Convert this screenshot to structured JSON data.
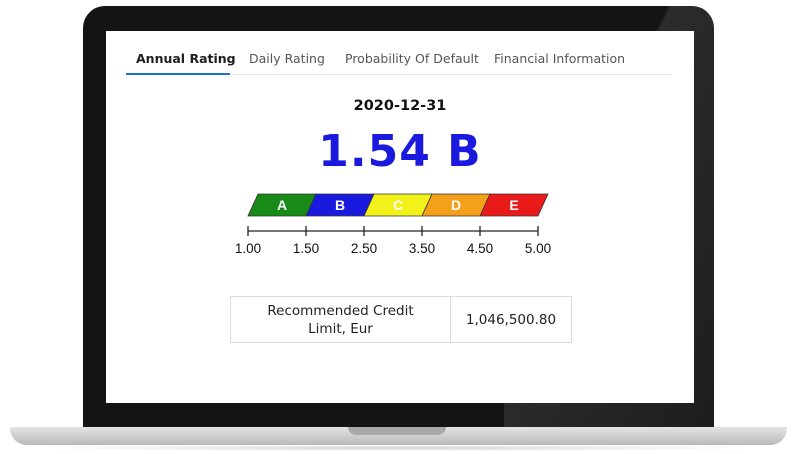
{
  "tabs": [
    {
      "label": "Annual Rating",
      "active": true
    },
    {
      "label": "Daily Rating",
      "active": false
    },
    {
      "label": "Probability Of Default",
      "active": false
    },
    {
      "label": "Financial Information",
      "active": false
    }
  ],
  "rating": {
    "date": "2020-12-31",
    "value": "1.54 B",
    "color": "#1a1adf"
  },
  "scale": {
    "bands": [
      {
        "label": "A",
        "color": "#188a18"
      },
      {
        "label": "B",
        "color": "#1a1adf"
      },
      {
        "label": "C",
        "color": "#f2f21a"
      },
      {
        "label": "D",
        "color": "#f5a01a"
      },
      {
        "label": "E",
        "color": "#e81a1a"
      }
    ],
    "ticks": [
      "1.00",
      "1.50",
      "2.50",
      "3.50",
      "4.50",
      "5.00"
    ]
  },
  "credit": {
    "label": "Recommended Credit Limit, Eur",
    "value": "1,046,500.80"
  }
}
